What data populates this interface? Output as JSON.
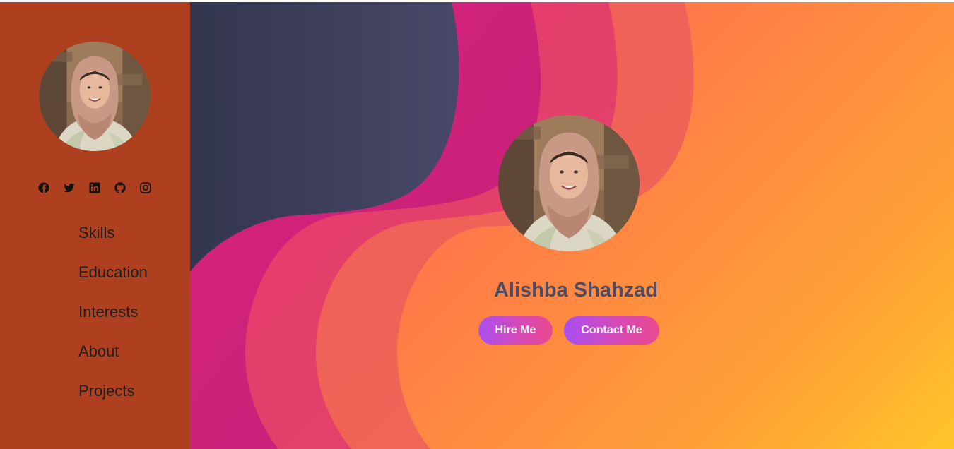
{
  "sidebar": {
    "social_icons": [
      "facebook-icon",
      "twitter-icon",
      "linkedin-icon",
      "github-icon",
      "instagram-icon"
    ],
    "nav": [
      {
        "label": "Skills"
      },
      {
        "label": "Education"
      },
      {
        "label": "Interests"
      },
      {
        "label": "About"
      },
      {
        "label": "Projects"
      }
    ]
  },
  "hero": {
    "name": "Alishba Shahzad",
    "hire_label": "Hire Me",
    "contact_label": "Contact Me"
  },
  "colors": {
    "sidebar_bg": "#ae3f1f",
    "dark_wave": "#3b3d5c",
    "magenta_wave": "#d3207a",
    "button_start": "#a94ef0",
    "button_end": "#ea4a8e",
    "name_color": "#4b4e66"
  }
}
